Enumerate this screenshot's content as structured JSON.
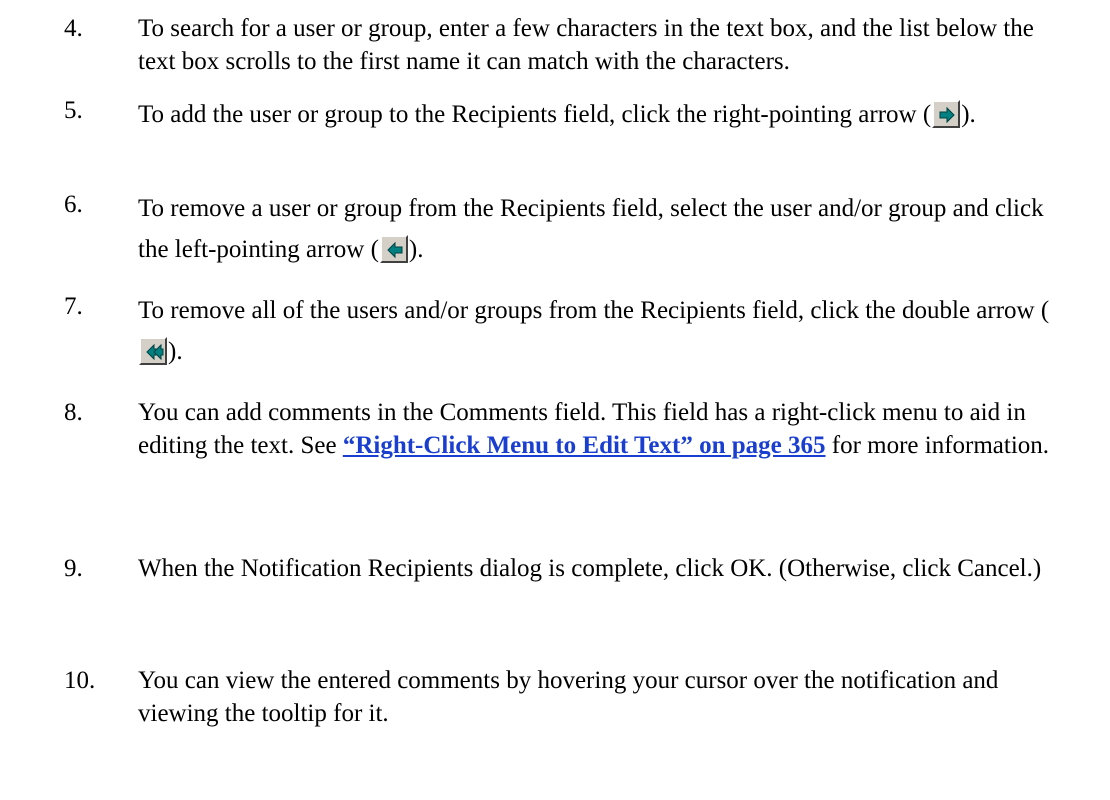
{
  "steps": [
    {
      "number": "4.",
      "text": "To search for a user or group, enter a few characters in the text box, and the list below the text box scrolls to the first name it can match with the characters."
    },
    {
      "number": "5.",
      "text_before": "To add the user or group to the Recipients field, click the right-pointing arrow (",
      "text_after": ").",
      "icon": "right-arrow-icon"
    },
    {
      "number": "6.",
      "text_before": "To remove a user or group from the Recipients field, select the user and/or group and click the left-pointing arrow (",
      "text_after": ").",
      "icon": "left-arrow-icon"
    },
    {
      "number": "7.",
      "text_before": "To remove all of the users and/or groups from the Recipients field, click the double arrow (",
      "text_after": ").",
      "icon": "double-left-arrow-icon"
    },
    {
      "number": "8.",
      "text_before": "You can add comments in the Comments field. This field has a right-click menu to aid in editing the text. See ",
      "link": "“Right-Click Menu to Edit Text” on page 365",
      "text_after": " for more information."
    },
    {
      "number": "9.",
      "text": "When the Notification Recipients dialog is complete, click OK. (Otherwise, click Cancel.)"
    },
    {
      "number": "10.",
      "text": "You can view the entered comments by hovering your cursor over the notification and viewing the tooltip for it."
    }
  ],
  "colors": {
    "link": "#1a3fd0",
    "button_face": "#d4d0c8",
    "arrow_fill": "#008080"
  }
}
